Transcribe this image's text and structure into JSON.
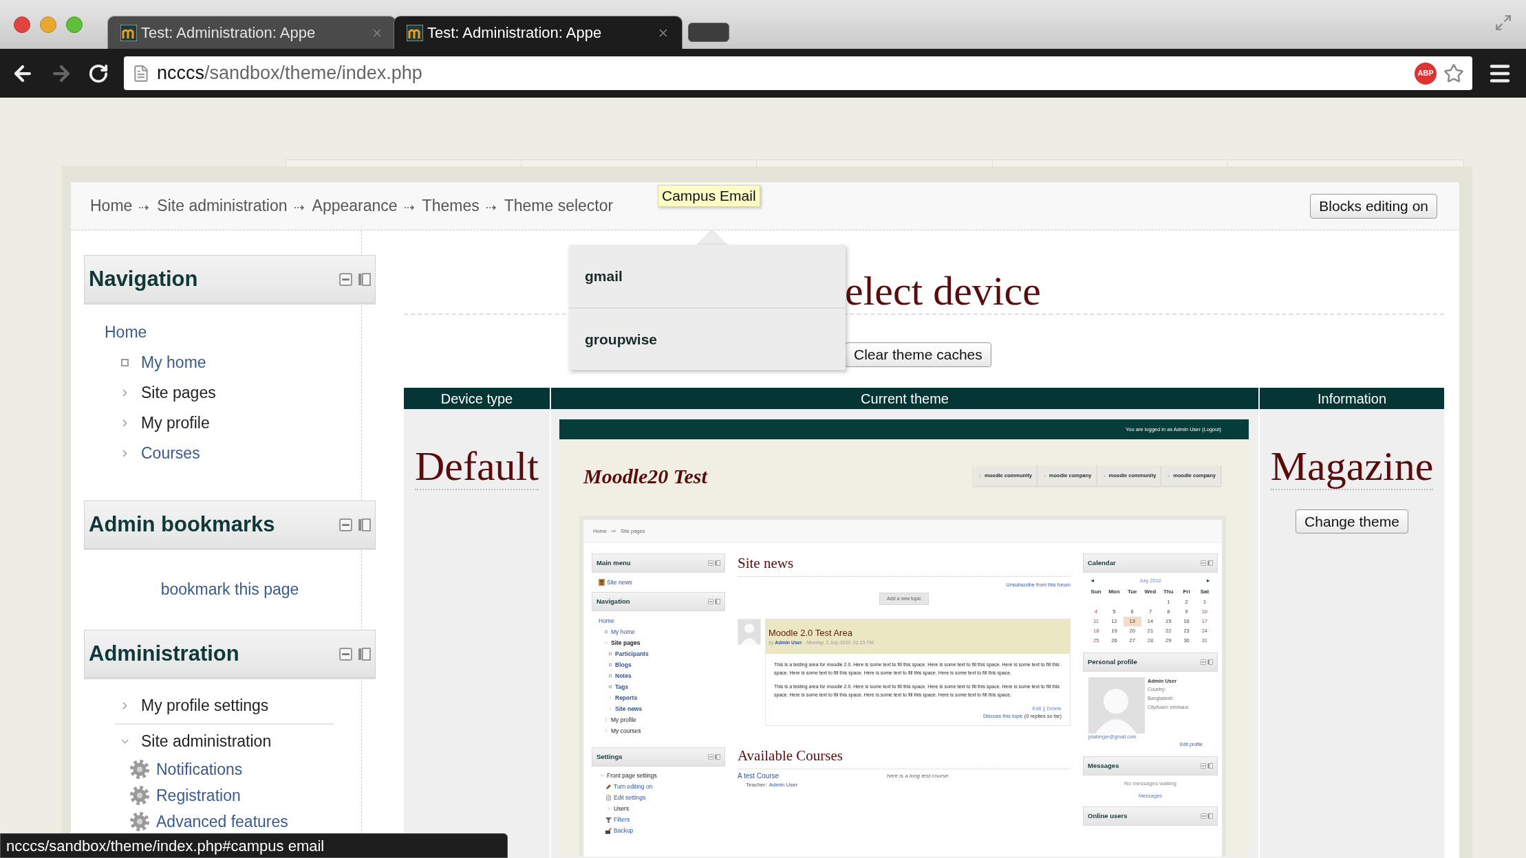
{
  "browser": {
    "tabs": [
      {
        "title": "Test: Administration: Appe",
        "selected": false
      },
      {
        "title": "Test: Administration: Appe",
        "selected": true
      }
    ],
    "address": {
      "host": "ncccs",
      "path": "/sandbox/theme/index.php"
    },
    "extension_badge": "ABP"
  },
  "breadcrumb": [
    "Home",
    "Site administration",
    "Appearance",
    "Themes",
    "Theme selector"
  ],
  "tooltip": "Campus Email",
  "blocks_editing_button": "Blocks editing on",
  "navigation": {
    "title": "Navigation",
    "items": [
      {
        "label": "Home",
        "link": true,
        "kind": "plain",
        "children": [
          {
            "label": "My home",
            "link": true,
            "kind": "leaf"
          },
          {
            "label": "Site pages",
            "link": false,
            "kind": "branch",
            "expanded": false
          },
          {
            "label": "My profile",
            "link": false,
            "kind": "branch",
            "expanded": false
          },
          {
            "label": "Courses",
            "link": true,
            "kind": "branch",
            "expanded": false
          }
        ]
      }
    ]
  },
  "admin_bookmarks": {
    "title": "Admin bookmarks",
    "link": "bookmark this page"
  },
  "administration": {
    "title": "Administration",
    "items": [
      {
        "label": "My profile settings",
        "link": false,
        "kind": "branch",
        "expanded": false
      },
      {
        "label": "Site administration",
        "link": false,
        "kind": "branch",
        "expanded": true,
        "children": [
          {
            "label": "Notifications",
            "link": true,
            "kind": "gear"
          },
          {
            "label": "Registration",
            "link": true,
            "kind": "gear"
          },
          {
            "label": "Advanced features",
            "link": true,
            "kind": "gear"
          }
        ]
      }
    ]
  },
  "dropdown": {
    "items": [
      "gmail",
      "groupwise"
    ]
  },
  "heading": "elect device",
  "clear_button": "Clear theme caches",
  "table": {
    "columns": [
      "Device type",
      "Current theme",
      "Information"
    ],
    "rows": [
      {
        "device": "Default",
        "theme_name": "Magazine",
        "button": "Change theme",
        "preview": {
          "login_info": "You are logged in as Admin User (Logout)",
          "site_name": "Moodle20 Test",
          "menu": [
            "moodle community",
            "moodle company",
            "moodle community",
            "moodle company"
          ],
          "breadcrumb": [
            "Home",
            "Site pages"
          ],
          "main_menu": {
            "title": "Main menu",
            "items": [
              {
                "label": "Site news",
                "link": true,
                "bold": false,
                "kind": "forum"
              }
            ]
          },
          "navigation": {
            "title": "Navigation",
            "items": [
              {
                "label": "Home",
                "link": true,
                "bold": false,
                "kind": "plain",
                "children": [
                  {
                    "label": "My home",
                    "link": true,
                    "bold": false,
                    "kind": "leaf"
                  },
                  {
                    "label": "Site pages",
                    "link": false,
                    "bold": true,
                    "kind": "branch",
                    "expanded": true,
                    "children": [
                      {
                        "label": "Participants",
                        "link": true,
                        "bold": true,
                        "kind": "leaf"
                      },
                      {
                        "label": "Blogs",
                        "link": true,
                        "bold": true,
                        "kind": "leaf"
                      },
                      {
                        "label": "Notes",
                        "link": true,
                        "bold": true,
                        "kind": "leaf"
                      },
                      {
                        "label": "Tags",
                        "link": true,
                        "bold": true,
                        "kind": "leaf"
                      },
                      {
                        "label": "Reports",
                        "link": true,
                        "bold": true,
                        "kind": "branch",
                        "expanded": false
                      },
                      {
                        "label": "Site news",
                        "link": true,
                        "bold": true,
                        "kind": "branch",
                        "expanded": false
                      }
                    ]
                  },
                  {
                    "label": "My profile",
                    "link": false,
                    "bold": false,
                    "kind": "branch",
                    "expanded": false
                  },
                  {
                    "label": "My courses",
                    "link": false,
                    "bold": false,
                    "kind": "branch",
                    "expanded": false
                  }
                ]
              }
            ]
          },
          "settings": {
            "title": "Settings",
            "items": [
              {
                "label": "Front page settings",
                "link": false,
                "bold": false,
                "kind": "branch",
                "expanded": true,
                "children": [
                  {
                    "label": "Turn editing on",
                    "link": true,
                    "bold": false,
                    "kind": "edit"
                  },
                  {
                    "label": "Edit settings",
                    "link": true,
                    "bold": false,
                    "kind": "doc"
                  },
                  {
                    "label": "Users",
                    "link": false,
                    "bold": false,
                    "kind": "branch",
                    "expanded": false
                  },
                  {
                    "label": "Filters",
                    "link": true,
                    "bold": false,
                    "kind": "filter"
                  },
                  {
                    "label": "Backup",
                    "link": true,
                    "bold": false,
                    "kind": "backup"
                  }
                ]
              }
            ]
          },
          "site_news": {
            "title": "Site news",
            "unsubscribe": "Unsubscribe from this forum",
            "add_button": "Add a new topic",
            "post": {
              "subject": "Moodle 2.0 Test Area",
              "by": "by",
              "author": "Admin User",
              "date": "- Monday, 5 July 2010, 01:15 PM",
              "paragraphs": [
                "This is a testing area for moodle 2.0. Here is some text to fill this space. Here is some text to fill this space. Here is some text to fill this space. Here is some text to fill this space. Here is some text to fill this space. Here is some text to fill this space.",
                "This is a testing area for moodle 2.0. Here is some text to fill this space. Here is some text to fill this space. Here is some text to fill this space. Here is some text to fill this space. Here is some text to fill this space. Here is some text to fill this space."
              ],
              "actions": [
                "Edit",
                "Delete"
              ],
              "separator": "|",
              "discuss": "Discuss this topic",
              "replies": "(0 replies so far)"
            }
          },
          "available_courses": {
            "title": "Available Courses",
            "courses": [
              {
                "name": "A test Course",
                "teacher_label": "Teacher:",
                "teacher": "Admin User",
                "summary": "here is a long test course"
              }
            ]
          },
          "calendar": {
            "title": "Calendar",
            "prev": "◄",
            "month": "July 2010",
            "next": "►",
            "day_names": [
              "Sun",
              "Mon",
              "Tue",
              "Wed",
              "Thu",
              "Fri",
              "Sat"
            ],
            "weeks": [
              {
                "days": [
                  {
                    "label": "1",
                    "kind": "weekday",
                    "selected": false
                  },
                  {
                    "label": "2",
                    "kind": "weekday",
                    "selected": false
                  },
                  {
                    "label": "3",
                    "kind": "weekend",
                    "selected": false
                  }
                ]
              },
              {
                "days": [
                  {
                    "label": "4",
                    "kind": "weekend",
                    "selected": false
                  },
                  {
                    "label": "5",
                    "kind": "weekday",
                    "selected": false
                  },
                  {
                    "label": "6",
                    "kind": "weekday",
                    "selected": false
                  },
                  {
                    "label": "7",
                    "kind": "weekday",
                    "selected": false
                  },
                  {
                    "label": "8",
                    "kind": "weekday",
                    "selected": false
                  },
                  {
                    "label": "9",
                    "kind": "weekday",
                    "selected": false
                  },
                  {
                    "label": "10",
                    "kind": "weekend",
                    "selected": false
                  }
                ]
              },
              {
                "days": [
                  {
                    "label": "11",
                    "kind": "weekend",
                    "selected": false
                  },
                  {
                    "label": "12",
                    "kind": "weekday",
                    "selected": false
                  },
                  {
                    "label": "13",
                    "kind": "weekday",
                    "selected": true
                  },
                  {
                    "label": "14",
                    "kind": "weekday",
                    "selected": false
                  },
                  {
                    "label": "15",
                    "kind": "weekday",
                    "selected": false
                  },
                  {
                    "label": "16",
                    "kind": "weekday",
                    "selected": false
                  },
                  {
                    "label": "17",
                    "kind": "weekend",
                    "selected": false
                  }
                ]
              },
              {
                "days": [
                  {
                    "label": "18",
                    "kind": "weekend",
                    "selected": false
                  },
                  {
                    "label": "19",
                    "kind": "weekday",
                    "selected": false
                  },
                  {
                    "label": "20",
                    "kind": "weekday",
                    "selected": false
                  },
                  {
                    "label": "21",
                    "kind": "weekday",
                    "selected": false
                  },
                  {
                    "label": "22",
                    "kind": "weekday",
                    "selected": false
                  },
                  {
                    "label": "23",
                    "kind": "weekday",
                    "selected": false
                  },
                  {
                    "label": "24",
                    "kind": "weekend",
                    "selected": false
                  }
                ]
              },
              {
                "days": [
                  {
                    "label": "25",
                    "kind": "weekend",
                    "selected": false
                  },
                  {
                    "label": "26",
                    "kind": "weekday",
                    "selected": false
                  },
                  {
                    "label": "27",
                    "kind": "weekday",
                    "selected": false
                  },
                  {
                    "label": "28",
                    "kind": "event",
                    "selected": false
                  },
                  {
                    "label": "29",
                    "kind": "weekday",
                    "selected": false
                  },
                  {
                    "label": "30",
                    "kind": "weekday",
                    "selected": false
                  },
                  {
                    "label": "31",
                    "kind": "weekend",
                    "selected": false
                  }
                ]
              }
            ]
          },
          "profile": {
            "title": "Personal profile",
            "name": "Admin User",
            "details": [
              "Country:",
              "Bangladesh",
              "City/town: emmaus"
            ],
            "email": "jstabinger@gmail.com",
            "edit": "Edit profile"
          },
          "messages": {
            "title": "Messages",
            "empty": "No messages waiting",
            "link": "Messages"
          },
          "online_users": {
            "title": "Online users"
          }
        }
      }
    ]
  },
  "status_url": "ncccs/sandbox/theme/index.php#campus email"
}
